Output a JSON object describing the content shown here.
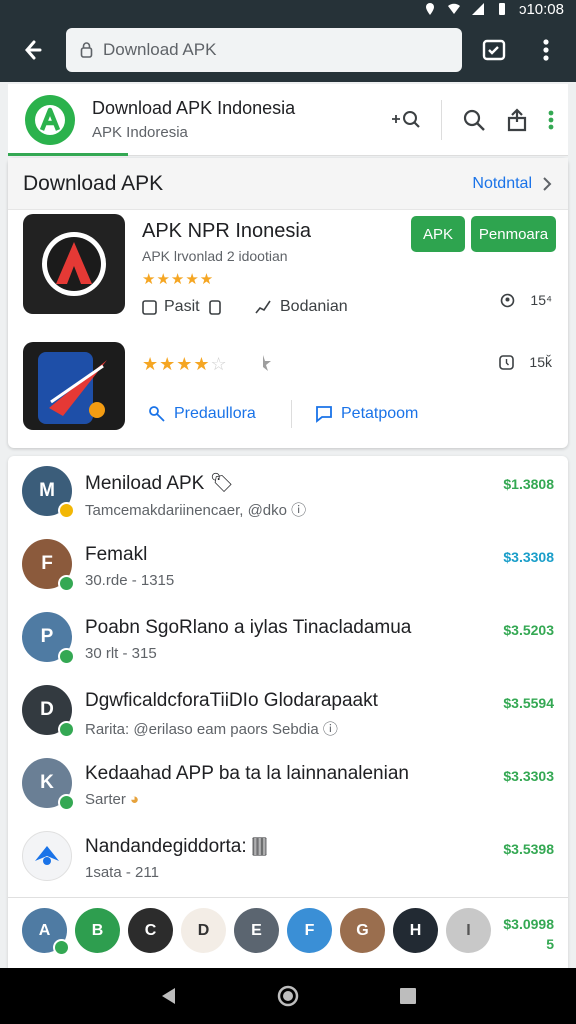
{
  "status_bar": {
    "time": "ɔ10:08"
  },
  "url_bar": {
    "value": "Download APK"
  },
  "site_header": {
    "title": "Download APK Indonesia",
    "subtitle": "APK Indoresia"
  },
  "featured_card": {
    "title": "Download APK",
    "link": "Notdntal",
    "app1": {
      "name": "APK NPR Inonesia",
      "description": "APK Ɩrvonlad 2 idootian",
      "rating": 5,
      "install_label": "APK",
      "download_label": "Penmoara",
      "meta_left": "Pasit",
      "meta_mid": "Bodanian",
      "meta_right": "15⁴"
    },
    "app2": {
      "rating": 4.5,
      "meta_right": "15ǩ",
      "action1": "Predaullora",
      "action2": "Petatpoom"
    }
  },
  "colors": {
    "green": "#34a853",
    "blue": "#1a73e8",
    "teal": "#1a9ec9",
    "header_bg": "#263238"
  },
  "list": [
    {
      "title": "Meniload APK 🏷",
      "subtitle": "Tamcemakdariinencaer, @dko",
      "price": "$1.3808",
      "price_color": "#34a853",
      "avatar_color": "#3b5d7a",
      "initials": "M"
    },
    {
      "title": "Femakl",
      "subtitle": "30.rde - 1315",
      "price": "$3.3308",
      "price_color": "#1a9ec9",
      "avatar_color": "#8b5a3c",
      "initials": "F"
    },
    {
      "title": "Poabn SgoRlano a iylas Tinacladamua",
      "subtitle": "30 rlt - 315",
      "price": "$3.5203",
      "price_color": "#34a853",
      "avatar_color": "#4f7ba3",
      "initials": "P"
    },
    {
      "title": "DgwficaldcforaTiiDIo Glodarapaakt",
      "subtitle": "Rarita: @erilaso eam paors Sebdia",
      "price": "$3.5594",
      "price_color": "#34a853",
      "avatar_color": "#333a40",
      "initials": "D"
    },
    {
      "title": "Kedaahad APP ba ta la lainnanalenian",
      "subtitle": "Sarter",
      "price": "$3.3303",
      "price_color": "#34a853",
      "avatar_color": "#6a7f95",
      "initials": "K"
    },
    {
      "title": "Nandandegiddorta: 🀫",
      "subtitle": "1sata - 211",
      "price": "$3.5398",
      "price_color": "#34a853",
      "avatar_color": "#f3f4f6",
      "initials": "N"
    }
  ],
  "strip": {
    "price_line1": "$3.0998",
    "price_line2": "5",
    "avatars": [
      {
        "initials": "A",
        "color": "#4f7ba3"
      },
      {
        "initials": "B",
        "color": "#2e9e4f"
      },
      {
        "initials": "C",
        "color": "#2c2c2c"
      },
      {
        "initials": "D",
        "color": "#f3ede6"
      },
      {
        "initials": "E",
        "color": "#5b6570"
      },
      {
        "initials": "F",
        "color": "#3a8fd6"
      },
      {
        "initials": "G",
        "color": "#9a6e4e"
      },
      {
        "initials": "H",
        "color": "#222a33"
      },
      {
        "initials": "I",
        "color": "#c8c8c8"
      }
    ]
  }
}
